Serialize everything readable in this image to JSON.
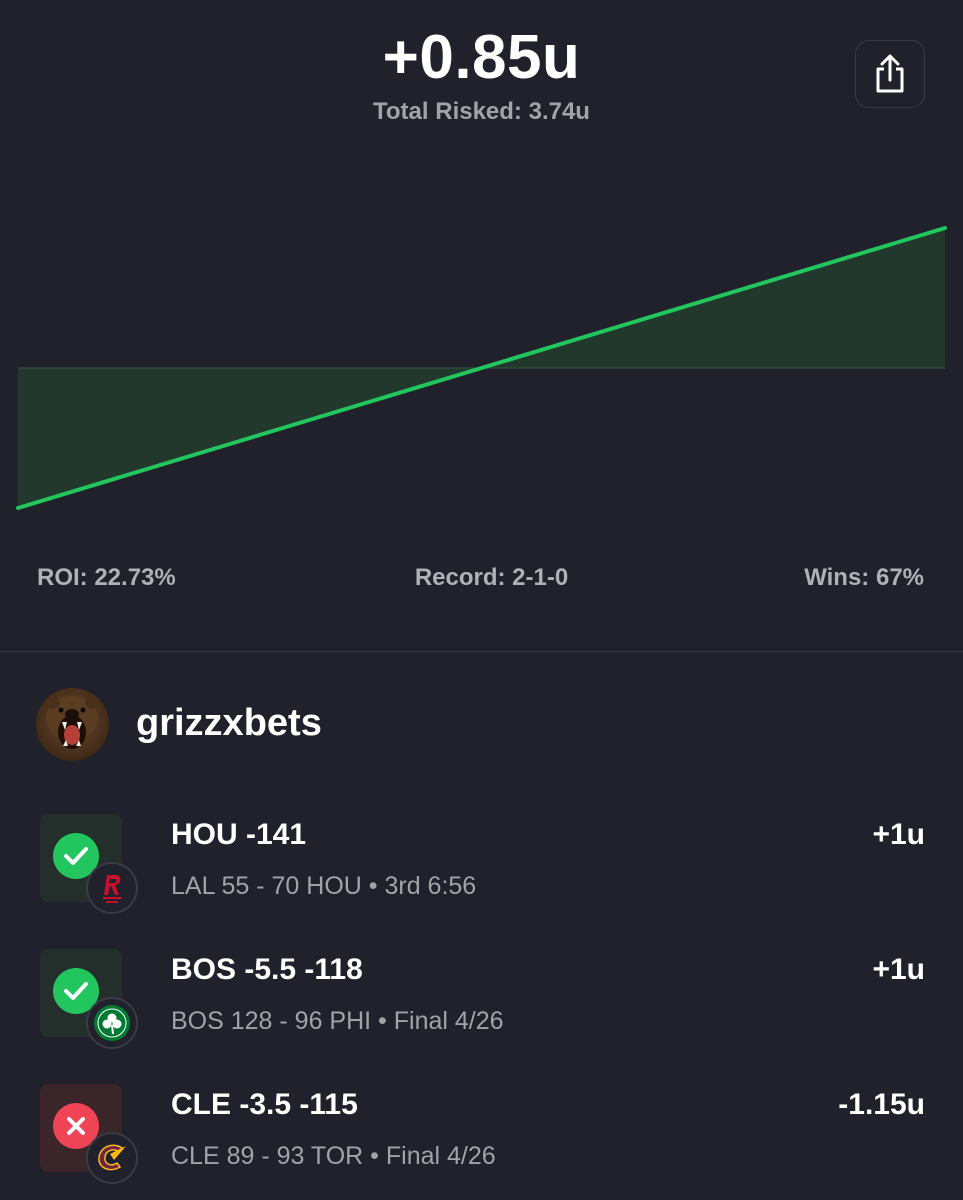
{
  "header": {
    "total_units": "+0.85u",
    "total_risked": "Total Risked: 3.74u",
    "share_icon": "share-icon"
  },
  "chart_data": {
    "type": "area",
    "x": [
      0,
      1
    ],
    "y": [
      -1,
      1
    ],
    "baseline": 0,
    "line_color": "#22c55e",
    "fill_color": "#22382c"
  },
  "stats": {
    "roi": "ROI: 22.73%",
    "record": "Record: 2-1-0",
    "wins": "Wins: 67%"
  },
  "profile": {
    "username": "grizzxbets",
    "avatar_icon": "bear-avatar"
  },
  "bets": [
    {
      "title": "HOU -141",
      "subtitle": "LAL 55 - 70 HOU • 3rd 6:56",
      "result": "+1u",
      "status": "win",
      "team_icon": "rockets-logo-icon"
    },
    {
      "title": "BOS -5.5 -118",
      "subtitle": "BOS 128 - 96 PHI • Final 4/26",
      "result": "+1u",
      "status": "win",
      "team_icon": "celtics-logo-icon"
    },
    {
      "title": "CLE -3.5 -115",
      "subtitle": "CLE 89 - 93 TOR • Final 4/26",
      "result": "-1.15u",
      "status": "loss",
      "team_icon": "cavaliers-logo-icon"
    }
  ],
  "colors": {
    "background": "#20212a",
    "win": "#22c55e",
    "loss": "#ef4455",
    "muted_text": "#a2a2a8"
  }
}
